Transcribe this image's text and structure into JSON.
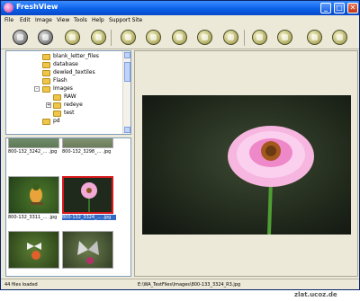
{
  "window": {
    "title": "FreshView",
    "buttons": {
      "minimize": "_",
      "maximize": "□",
      "close": "✕"
    }
  },
  "menu": [
    "File",
    "Edit",
    "Image",
    "View",
    "Tools",
    "Help",
    "Support Site"
  ],
  "toolbar": {
    "icons": [
      "back-icon",
      "forward-icon",
      "open-icon",
      "slideshow-icon",
      "copy-icon",
      "move-icon",
      "rename-icon",
      "delete-icon",
      "print-icon",
      "rotate-left-icon",
      "rotate-right-icon",
      "zoom-in-icon",
      "zoom-out-icon"
    ]
  },
  "tree": {
    "items": [
      {
        "label": "blank_letter_files"
      },
      {
        "label": "database"
      },
      {
        "label": "dewled_textiles"
      },
      {
        "label": "Flash"
      },
      {
        "label": "Images",
        "expander": "-"
      },
      {
        "label": "RAW"
      },
      {
        "label": "redeye",
        "expander": "+"
      },
      {
        "label": "test"
      },
      {
        "label": "pd"
      }
    ]
  },
  "thumbnails": [
    {
      "caption": "800-132_3242_... .jpg",
      "selected": false
    },
    {
      "caption": "800-132_3298_... .jpg",
      "selected": false
    },
    {
      "caption": "800-132_3311_... .jpg",
      "selected": false
    },
    {
      "caption": "800-132_3324_... .jpg",
      "selected": true
    },
    {
      "caption": "",
      "selected": false
    },
    {
      "caption": "",
      "selected": false
    }
  ],
  "status": {
    "loaded": "44 files loaded",
    "path": "E:\\WA_TestFiles\\Images\\800-133_3324_R3.jpg"
  },
  "watermark": "zlat.ucoz.de"
}
